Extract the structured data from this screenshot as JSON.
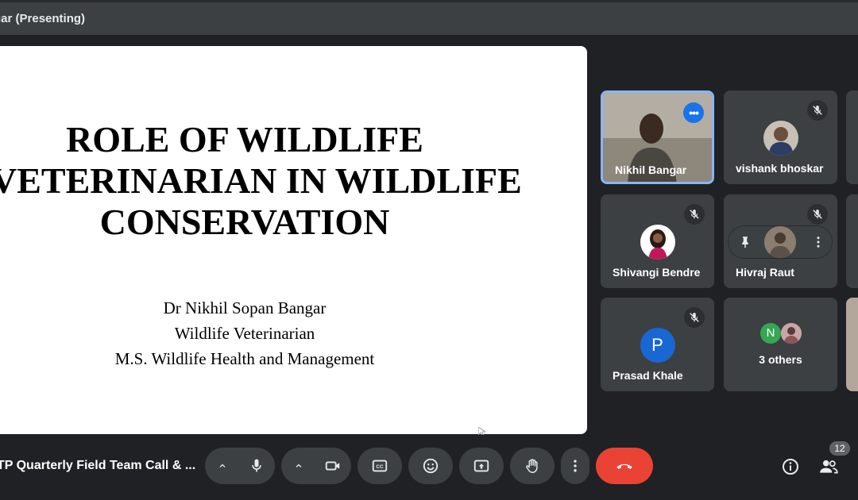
{
  "window": {
    "title": "gar (Presenting)"
  },
  "slide": {
    "title_lines": [
      "ROLE OF WILDLIFE",
      "VETERINARIAN IN WILDLIFE",
      "CONSERVATION"
    ],
    "subtitle_lines": [
      "Dr Nikhil Sopan Bangar",
      "Wildlife Veterinarian",
      "M.S. Wildlife Health and Management"
    ]
  },
  "participants": [
    {
      "name": "Nikhil Bangar",
      "state": "speaking-video"
    },
    {
      "name": "vishank bhoskar",
      "state": "muted"
    },
    {
      "name": "Shivangi Bendre",
      "state": "muted"
    },
    {
      "name": "Hivraj Raut",
      "state": "muted"
    },
    {
      "name": "Prasad Khale",
      "initial": "P",
      "state": "muted"
    },
    {
      "name": "3 others",
      "initial": "N"
    }
  ],
  "bottom": {
    "meeting_name": "TP Quarterly Field Team Call & ...",
    "participant_count": "12"
  },
  "colors": {
    "accent": "#8ab4f8",
    "end_call": "#ea4335",
    "blue": "#1a73e8",
    "avatar_p": "#1967d2",
    "avatar_n": "#34a853"
  }
}
